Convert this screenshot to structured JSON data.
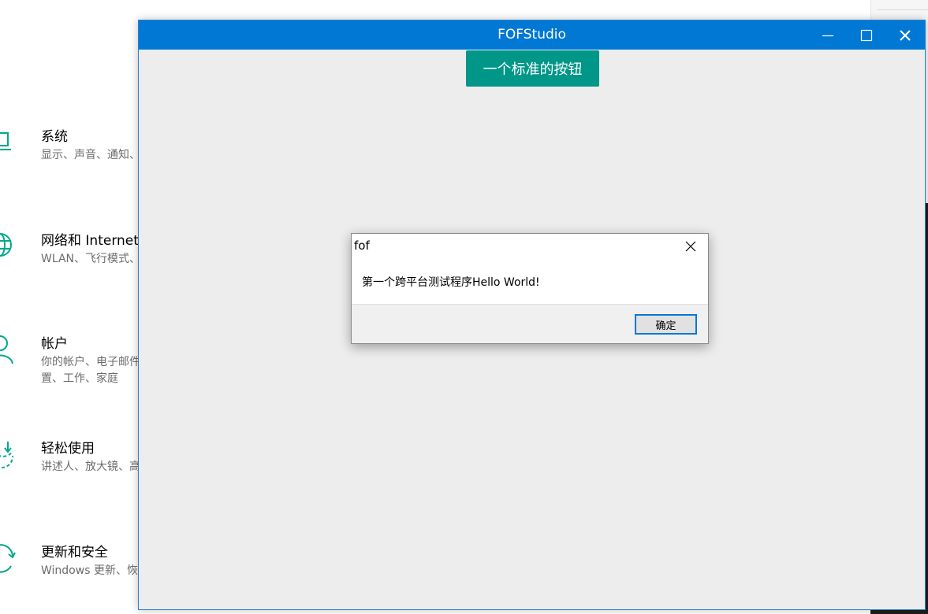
{
  "settings": {
    "categories": [
      {
        "title": "系统",
        "desc": "显示、声音、通知、",
        "icon": "laptop-icon"
      },
      {
        "title": "网络和 Internet",
        "desc": "WLAN、飞行模式、",
        "icon": "globe-icon"
      },
      {
        "title": "帐户",
        "desc": "你的帐户、电子邮件、置、工作、家庭",
        "icon": "person-icon"
      },
      {
        "title": "轻松使用",
        "desc": "讲述人、放大镜、高",
        "icon": "ease-of-access-icon"
      },
      {
        "title": "更新和安全",
        "desc": "Windows 更新、恢",
        "icon": "sync-icon"
      }
    ]
  },
  "app": {
    "title": "FOFStudio",
    "button_label": "一个标准的按钮"
  },
  "dialog": {
    "title": "fof",
    "message": "第一个跨平台测试程序Hello World!",
    "ok_label": "确定"
  },
  "colors": {
    "titlebar": "#0078d4",
    "accent_button": "#009688",
    "settings_icon": "#00a88a"
  }
}
